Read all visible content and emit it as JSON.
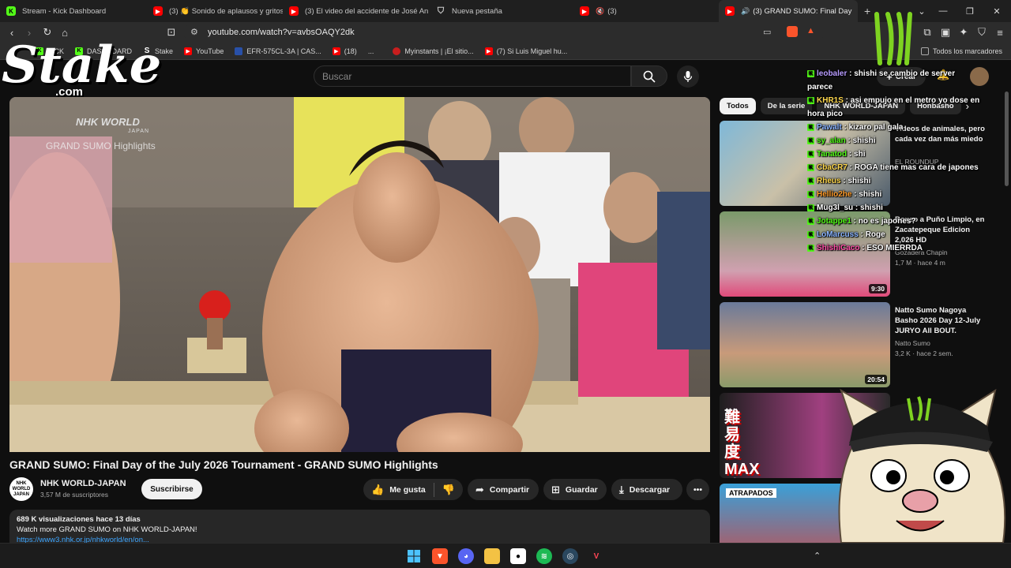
{
  "tabs": [
    {
      "title": "Stream - Kick Dashboard",
      "icon": "kick-icon"
    },
    {
      "title": "(3) 👏 Sonido de aplausos y gritos d",
      "icon": "youtube-icon"
    },
    {
      "title": "(3) El video del accidente de José An",
      "icon": "youtube-icon"
    },
    {
      "title": "Nueva pestaña",
      "icon": "shield-icon"
    },
    {
      "title": "(3)",
      "icon": "youtube-icon"
    },
    {
      "title": "(3) GRAND SUMO: Final Day",
      "icon": "youtube-icon",
      "active": true
    }
  ],
  "address": {
    "url": "youtube.com/watch?v=avbsOAQY2dk"
  },
  "bookmarks": [
    {
      "label": "KICK"
    },
    {
      "label": "DASHBOARD"
    },
    {
      "label": "Stake"
    },
    {
      "label": "YouTube"
    },
    {
      "label": "EFR-575CL-3A | CAS..."
    },
    {
      "label": "(18)"
    },
    {
      "label": "..."
    },
    {
      "label": "Myinstants | ¡El sitio..."
    },
    {
      "label": "(7) Si Luis Miguel hu..."
    }
  ],
  "all_bookmarks": "Todos los marcadores",
  "overlay": {
    "brand": "Stake",
    "brand_sub": ".com"
  },
  "youtube": {
    "search_placeholder": "Buscar",
    "create_label": "Crear",
    "player": {
      "watermark": "NHK WORLD",
      "watermark_sub": "JAPAN",
      "caption": "GRAND SUMO Highlights"
    },
    "video_title": "GRAND SUMO: Final Day of the July 2026 Tournament - GRAND SUMO Highlights",
    "channel": {
      "name": "NHK WORLD-JAPAN",
      "subs": "3,57 M de suscriptores",
      "avatar_text": "NHK WORLD JAPAN"
    },
    "subscribe": "Suscribirse",
    "actions": {
      "like": "Me gusta",
      "share": "Compartir",
      "save": "Guardar",
      "download": "Descargar"
    },
    "description": {
      "stats": "689 K visualizaciones  hace 13 días",
      "line1": "Watch more GRAND SUMO on NHK WORLD-JAPAN!",
      "link": "https://www3.nhk.or.jp/nhkworld/en/on..."
    },
    "chips": [
      "Todos",
      "De la serie",
      "NHK WORLD-JAPAN",
      "Honbasho"
    ],
    "recommendations": [
      {
        "title": "Videos de animales, pero cada vez dan más miedo",
        "channel": "EL ROUNDUP",
        "meta": "",
        "duration": ""
      },
      {
        "title": "Boxeo a Puño Limpio, en Zacatepeque Edicion 2,026 HD",
        "channel": "Gozadera Chapin",
        "meta": "1,7 M · hace 4 m",
        "duration": "9:30"
      },
      {
        "title": "Natto Sumo Nagoya Basho 2026 Day 12-July JURYO All BOUT.",
        "channel": "Natto Sumo",
        "meta": "3,2 K · hace 2 sem.",
        "duration": "20:54"
      },
      {
        "title": "",
        "channel": "",
        "meta": "",
        "duration": "",
        "thumb_text": "難易度MAX 地獄の道"
      },
      {
        "title": "",
        "channel": "",
        "meta": "",
        "duration": "",
        "thumb_text": "ATRAPADOS"
      }
    ]
  },
  "chat": [
    {
      "user": "leobaler",
      "color": "#b89cff",
      "msg": "shishi se cambio de server"
    },
    {
      "user": "",
      "color": "#fff",
      "msg": "parece"
    },
    {
      "user": "KHR1S",
      "color": "#ffd84d",
      "msg": "asi empujo en el metro yo dose en"
    },
    {
      "user": "",
      "color": "#fff",
      "msg": "hora pico"
    },
    {
      "user": "Pawalt",
      "color": "#8ab4ff",
      "msg": "kizaro pal gala"
    },
    {
      "user": "sy_alan",
      "color": "#53fc18",
      "msg": "shishi"
    },
    {
      "user": "Tanatod",
      "color": "#53fc18",
      "msg": "shi"
    },
    {
      "user": "CbaCR7",
      "color": "#ffd84d",
      "msg": "ROGA tiene mas cara de japones"
    },
    {
      "user": "Rheus",
      "color": "#ffd84d",
      "msg": "shishi"
    },
    {
      "user": "Hellio2he",
      "color": "#ff9c2a",
      "msg": "shishi"
    },
    {
      "user": "Mug3l_su",
      "color": "#fff",
      "msg": "shishi"
    },
    {
      "user": "Jotappe1",
      "color": "#53fc18",
      "msg": "no es japones?"
    },
    {
      "user": "LoMarcuss",
      "color": "#8ab4ff",
      "msg": "Roge"
    },
    {
      "user": "ShishiCaco",
      "color": "#ff4fa8",
      "msg": "ESO MIERRDA"
    }
  ],
  "taskbar": [
    {
      "icon": "windows-start-icon"
    },
    {
      "icon": "brave-icon"
    },
    {
      "icon": "discord-icon"
    },
    {
      "icon": "file-explorer-icon"
    },
    {
      "icon": "obs-icon"
    },
    {
      "icon": "spotify-icon"
    },
    {
      "icon": "steam-icon"
    },
    {
      "icon": "valorant-icon"
    }
  ],
  "colors": {
    "accent": "#ff0000",
    "kick_green": "#53fc18",
    "link": "#3ea6ff",
    "bg": "#0f0f0f"
  }
}
